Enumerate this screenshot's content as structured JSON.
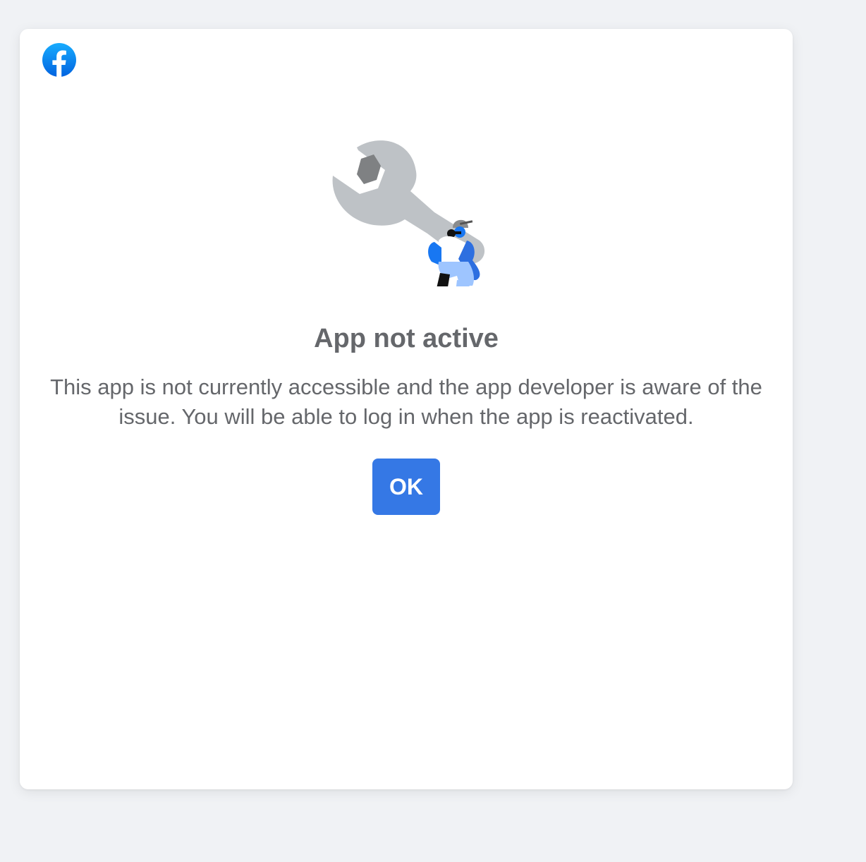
{
  "brand": {
    "logo_icon": "facebook-logo-icon",
    "color": "#1877f2"
  },
  "illustration": {
    "icon": "wrench-worker-illustration"
  },
  "dialog": {
    "title": "App not active",
    "message": "This app is not currently accessible and the app developer is aware of the issue. You will be able to log in when the app is reactivated.",
    "ok_label": "OK"
  },
  "colors": {
    "page_background": "#f0f2f5",
    "card_background": "#ffffff",
    "text": "#65676b",
    "button": "#3578e5",
    "button_text": "#ffffff"
  }
}
